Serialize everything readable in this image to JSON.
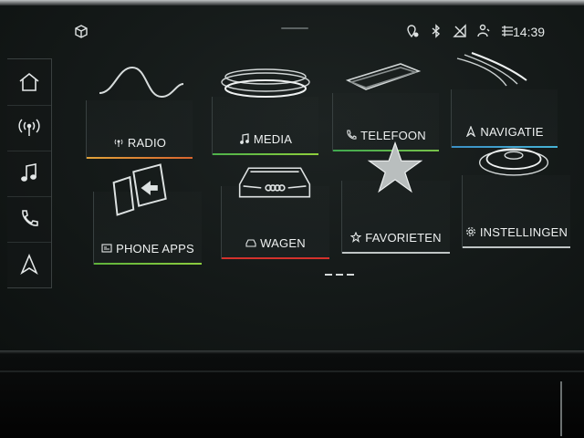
{
  "status": {
    "time": "14:39",
    "icons": [
      "cube-icon",
      "location-icon",
      "bluetooth-icon",
      "no-signal-icon",
      "user-icon",
      "data-icon"
    ]
  },
  "rail": {
    "items": [
      {
        "name": "home",
        "icon": "home-icon"
      },
      {
        "name": "radio",
        "icon": "antenna-icon"
      },
      {
        "name": "media",
        "icon": "music-note-icon"
      },
      {
        "name": "phone",
        "icon": "phone-icon"
      },
      {
        "name": "navigation",
        "icon": "navigation-arrow-icon"
      }
    ]
  },
  "tiles": [
    {
      "id": "radio",
      "label": "RADIO",
      "icon": "antenna-icon",
      "accent": "#e0a23a"
    },
    {
      "id": "media",
      "label": "MEDIA",
      "icon": "music-note-icon",
      "accent": "#5fbf4e"
    },
    {
      "id": "telefoon",
      "label": "TELEFOON",
      "icon": "phone-icon",
      "accent": "#4fae5a"
    },
    {
      "id": "navigatie",
      "label": "NAVIGATIE",
      "icon": "navigation-arrow-icon",
      "accent": "#3d93c8"
    },
    {
      "id": "phone-apps",
      "label": "PHONE APPS",
      "icon": "phone-apps-icon",
      "accent": "#6cbf3f"
    },
    {
      "id": "wagen",
      "label": "WAGEN",
      "icon": "car-icon",
      "accent": "#d3312c"
    },
    {
      "id": "favorieten",
      "label": "FAVORIETEN",
      "icon": "star-icon",
      "accent": "#bfc5c5"
    },
    {
      "id": "instellingen",
      "label": "INSTELLINGEN",
      "icon": "gear-icon",
      "accent": "#bfc5c5"
    }
  ],
  "pager": {
    "pages": 3,
    "current": 1
  }
}
